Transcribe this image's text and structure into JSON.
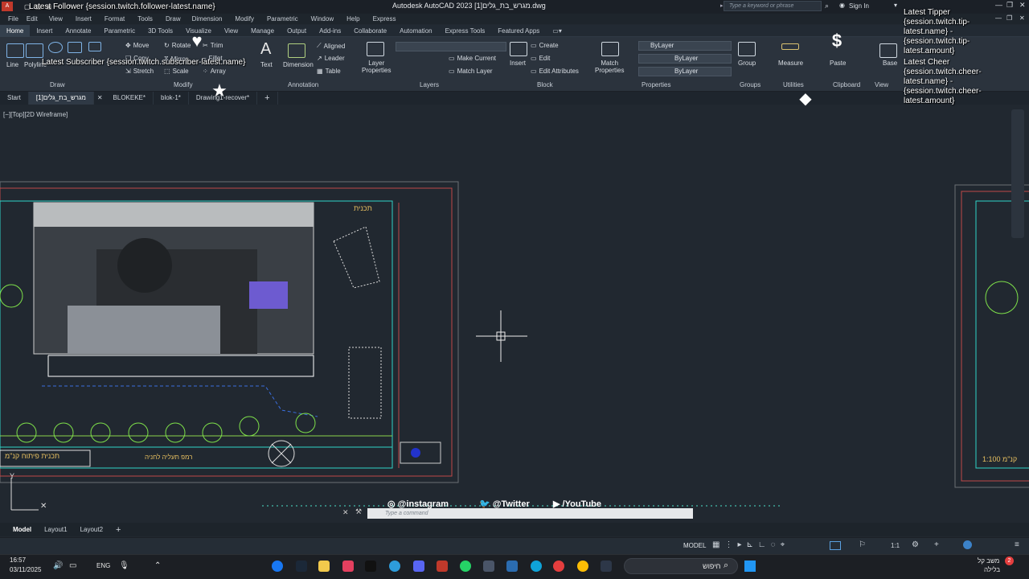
{
  "window": {
    "title": "Autodesk AutoCAD 2023  ‎[1]מגרש_בת_גלים.dwg",
    "search_placeholder": "Type a keyword or phrase",
    "sign_in": "Sign In"
  },
  "menu": [
    "File",
    "Edit",
    "View",
    "Insert",
    "Format",
    "Tools",
    "Draw",
    "Dimension",
    "Modify",
    "Parametric",
    "Window",
    "Help",
    "Express"
  ],
  "ribbon_tabs": [
    "Home",
    "Insert",
    "Annotate",
    "Parametric",
    "3D Tools",
    "Visualize",
    "View",
    "Manage",
    "Output",
    "Add-ins",
    "Collaborate",
    "Automation",
    "Express Tools",
    "Featured Apps"
  ],
  "ribbon": {
    "draw": {
      "label": "Draw",
      "line": "Line",
      "polyline": "Polyline"
    },
    "modify": {
      "label": "Modify",
      "move": "Move",
      "rotate": "Rotate",
      "trim": "Trim",
      "copy": "Copy",
      "mirror": "Mirror",
      "fillet": "Fillet",
      "stretch": "Stretch",
      "scale": "Scale",
      "array": "Array"
    },
    "annotation": {
      "label": "Annotation",
      "text": "Text",
      "dimension": "Dimension",
      "aligned": "Aligned",
      "leader": "Leader",
      "table": "Table"
    },
    "layers": {
      "label": "Layers",
      "layer_properties": "Layer Properties",
      "make_current": "Make Current",
      "match_layer": "Match Layer"
    },
    "block": {
      "label": "Block",
      "insert": "Insert",
      "create": "Create",
      "edit": "Edit",
      "edit_attributes": "Edit Attributes"
    },
    "properties": {
      "label": "Properties",
      "match_properties": "Match Properties",
      "color": "ByLayer",
      "linetype": "ByLayer",
      "lineweight": "ByLayer"
    },
    "groups": {
      "label": "Groups",
      "group": "Group"
    },
    "utilities": {
      "label": "Utilities",
      "measure": "Measure"
    },
    "clipboard": {
      "label": "Clipboard",
      "paste": "Paste"
    },
    "view": {
      "label": "View",
      "base": "Base"
    }
  },
  "doc_tabs": [
    "Start",
    "[1]מגרש_בת_גלים",
    "BLOKEKE*",
    "blok-1*",
    "Drawing1-recover*"
  ],
  "viewport_label": "[−][Top][2D Wireframe]",
  "overlays": {
    "follower": "Latest Follower {session.twitch.follower-latest.name}",
    "subscriber": "Latest Subscriber {session.twitch.subscriber-latest.name}",
    "tipper": "Latest Tipper\n{session.twitch.tip-latest.name} - {session.twitch.tip-latest.amount}",
    "cheer": "Latest Cheer\n{session.twitch.cheer-latest.name} - {session.twitch.cheer-latest.amount}",
    "instagram": "@instagram",
    "twitter": "@Twitter",
    "youtube": "/YouTube"
  },
  "drawing_labels": {
    "plan_title": "תכנית פיתוח קנ\"מ",
    "planter": "רמפ תעליה לחניה",
    "scale_right": "קנ\"מ 1:100",
    "corner": "תכנית"
  },
  "command_placeholder": "Type a command",
  "layout_tabs": [
    "Model",
    "Layout1",
    "Layout2"
  ],
  "status": {
    "model": "MODEL",
    "scale": "1:1"
  },
  "taskbar": {
    "time": "16:57",
    "date": "03/11/2025",
    "lang": "ENG",
    "search_placeholder": "חיפוש",
    "weather": "משב קל",
    "weather2": "בלילה",
    "notif": "2"
  }
}
